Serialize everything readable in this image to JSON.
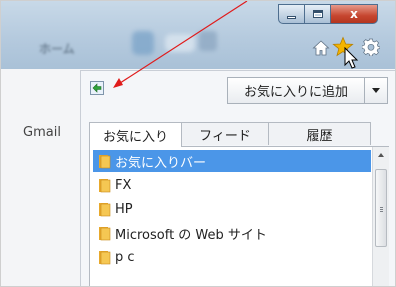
{
  "colors": {
    "accent": "#4b96e8",
    "annotation_arrow": "#e01b1b",
    "star": "#f4b400",
    "close_button": "#c6462f"
  },
  "toolbar": {
    "blurred_text": "ホーム",
    "icons": [
      "home-icon",
      "favorites-star-icon",
      "gear-icon"
    ]
  },
  "window_buttons": {
    "close_label": "x"
  },
  "sidebar": {
    "gmail_label": "Gmail"
  },
  "favorites_center": {
    "add_button_label": "お気に入りに追加",
    "tabs": [
      {
        "label": "お気に入り",
        "active": true
      },
      {
        "label": "フィード",
        "active": false
      },
      {
        "label": "履歴",
        "active": false
      }
    ],
    "items": [
      {
        "label": "お気に入りバー",
        "selected": true
      },
      {
        "label": "FX",
        "selected": false
      },
      {
        "label": "HP",
        "selected": false
      },
      {
        "label": "Microsoft の Web サイト",
        "selected": false
      },
      {
        "label": "p c",
        "selected": false
      }
    ]
  }
}
